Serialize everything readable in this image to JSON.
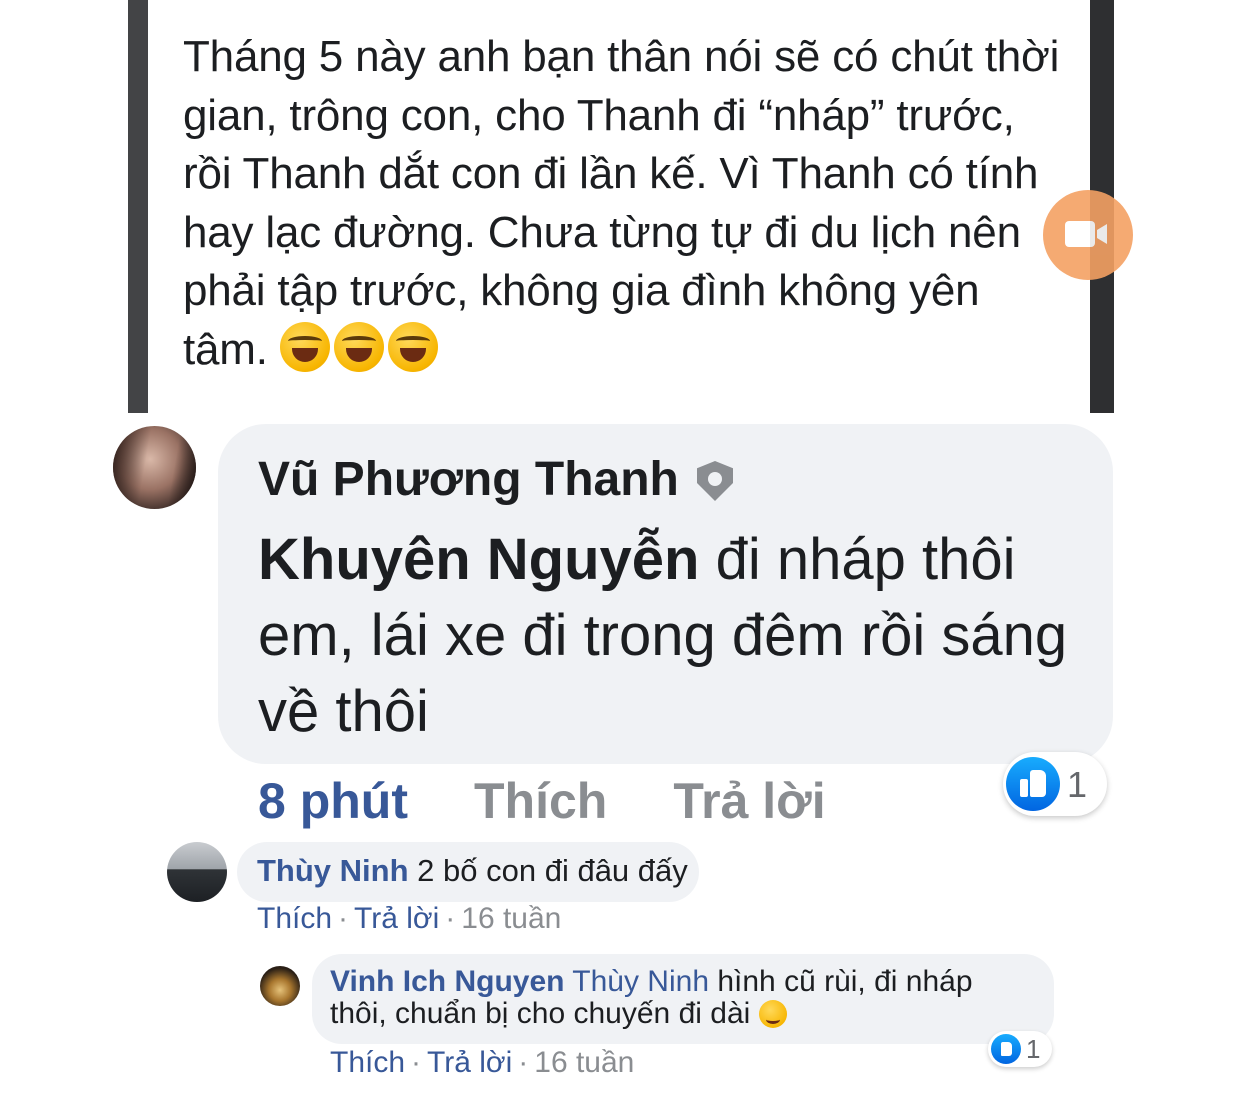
{
  "post": {
    "text": "Tháng 5 này anh bạn thân nói sẽ có chút thời gian, trông con, cho Thanh đi “nháp” trước, rồi Thanh dắt con đi lần kế. Vì Thanh có tính hay lạc đường. Chưa từng tự đi du lịch nên phải tập trước, không gia đình không yên tâm.",
    "emojis": [
      "rofl-emoji",
      "rofl-emoji",
      "rofl-emoji"
    ]
  },
  "main_comment": {
    "author": "Vũ Phương Thanh",
    "tagged": "Khuyên Nguyễn",
    "text": " đi nháp thôi em, lái xe đi trong đêm rồi sáng về thôi",
    "time": "8 phút",
    "like_label": "Thích",
    "reply_label": "Trả lời",
    "reaction_count": "1"
  },
  "reply1": {
    "author": "Thùy Ninh",
    "text": "2 bố con đi đâu đấy",
    "like_label": "Thích",
    "reply_label": "Trả lời",
    "time": "16 tuần"
  },
  "reply2": {
    "author": "Vinh Ich Nguyen",
    "tagged": "Thùy Ninh",
    "text": " hình cũ rùi, đi nháp thôi, chuẩn bị cho chuyến đi dài",
    "like_label": "Thích",
    "reply_label": "Trả lời",
    "time": "16 tuần",
    "reaction_count": "1"
  },
  "colors": {
    "link_blue": "#385898",
    "bubble_bg": "#f0f2f5",
    "meta_gray": "#8a8d91",
    "like_blue": "#0165e1"
  }
}
